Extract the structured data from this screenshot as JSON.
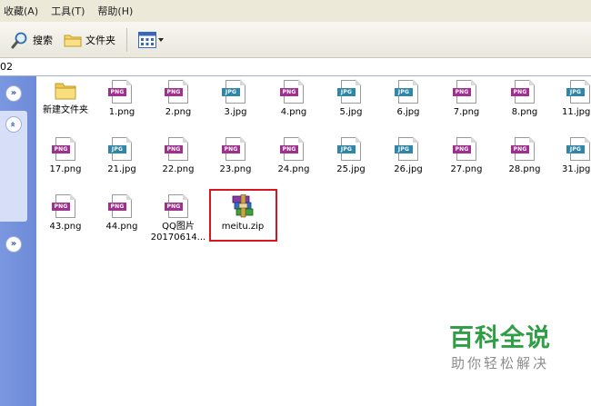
{
  "menu": {
    "favorites": "收藏(A)",
    "tools": "工具(T)",
    "help": "帮助(H)"
  },
  "toolbar": {
    "search_label": "搜索",
    "folders_label": "文件夹"
  },
  "address": {
    "text": "02"
  },
  "files_row1": [
    {
      "name": "新建文件夹",
      "type": "folder"
    },
    {
      "name": "1.png",
      "type": "png"
    },
    {
      "name": "2.png",
      "type": "png"
    },
    {
      "name": "3.jpg",
      "type": "jpg"
    },
    {
      "name": "4.png",
      "type": "png"
    },
    {
      "name": "5.jpg",
      "type": "jpg"
    },
    {
      "name": "6.jpg",
      "type": "jpg"
    },
    {
      "name": "7.png",
      "type": "png"
    },
    {
      "name": "8.png",
      "type": "png"
    },
    {
      "name": "11.jpg",
      "type": "jpg"
    }
  ],
  "files_row2": [
    {
      "name": "17.png",
      "type": "png"
    },
    {
      "name": "21.jpg",
      "type": "jpg"
    },
    {
      "name": "22.png",
      "type": "png"
    },
    {
      "name": "23.png",
      "type": "png"
    },
    {
      "name": "24.png",
      "type": "png"
    },
    {
      "name": "25.jpg",
      "type": "jpg"
    },
    {
      "name": "26.jpg",
      "type": "jpg"
    },
    {
      "name": "27.png",
      "type": "png"
    },
    {
      "name": "28.png",
      "type": "png"
    },
    {
      "name": "31.jpg",
      "type": "jpg"
    }
  ],
  "files_row3": [
    {
      "name": "43.png",
      "type": "png"
    },
    {
      "name": "44.png",
      "type": "png"
    },
    {
      "name": "QQ图片",
      "name2": "20170614...",
      "type": "png"
    },
    {
      "name": "meitu.zip",
      "type": "zip"
    }
  ],
  "type_labels": {
    "png": "PNG",
    "jpg": "JPG"
  },
  "watermark": {
    "title": "百科全说",
    "subtitle": "助你轻松解决"
  },
  "colors": {
    "png_tag": "#a0308f",
    "jpg_tag": "#2f86a8",
    "highlight": "#d8161e",
    "watermark": "#2f9e44"
  }
}
